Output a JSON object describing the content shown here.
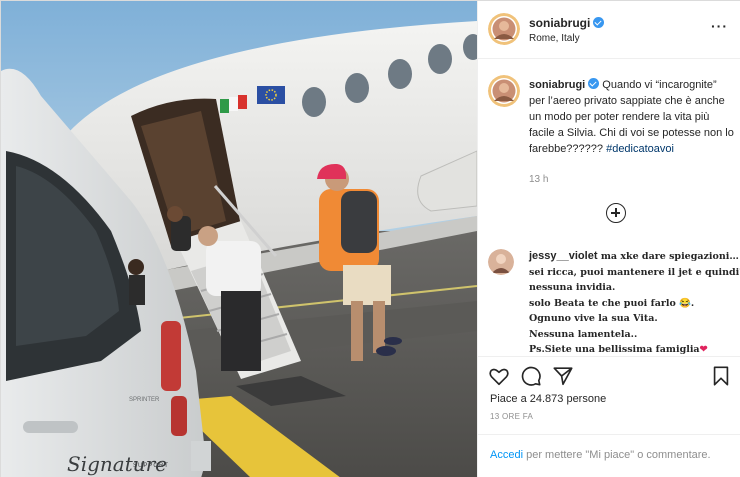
{
  "post": {
    "username": "soniabrugi",
    "verified": true,
    "location": "Rome, Italy",
    "more_icon": "ellipsis-icon"
  },
  "caption": {
    "username": "soniabrugi",
    "text": "Quando vi “incarognite” per l’aereo privato sappiate che è anche un modo per poter rendere la vita più facile a Silvia. Chi di voi se potesse non lo farebbe??????",
    "hashtag": "#dedicatoavoi",
    "time": "13 h"
  },
  "load_more_icon": "plus-circle-icon",
  "comment": {
    "username": "jessy__violet",
    "lines": [
      "ma xke dare spiegazioni…",
      "sei ricca, puoi mantenere il jet e quindi???",
      "nessuna invidia.",
      "solo Beata te che puoi farlo 😂.",
      "Ognuno vive la sua Vita.",
      "Nessuna lamentela..",
      "Ps.Siete una bellissima famiglia"
    ],
    "trailing_emoji": "❤"
  },
  "actions": {
    "icons": [
      "heart-icon",
      "comment-icon",
      "share-icon",
      "bookmark-icon"
    ],
    "likes": "Piace a 24.873 persone",
    "time_ago": "13 ORE FA"
  },
  "login": {
    "link": "Accedi",
    "text": " per mettere \"Mi piace\" o commentare."
  },
  "photo_text": {
    "van_brand": "Signature",
    "van_sub": "SUPPORT",
    "van_model": "SPRINTER"
  },
  "colors": {
    "verified": "#3897f0",
    "link": "#0095f6",
    "hashtag": "#00376b",
    "muted": "#8e8e8e"
  }
}
